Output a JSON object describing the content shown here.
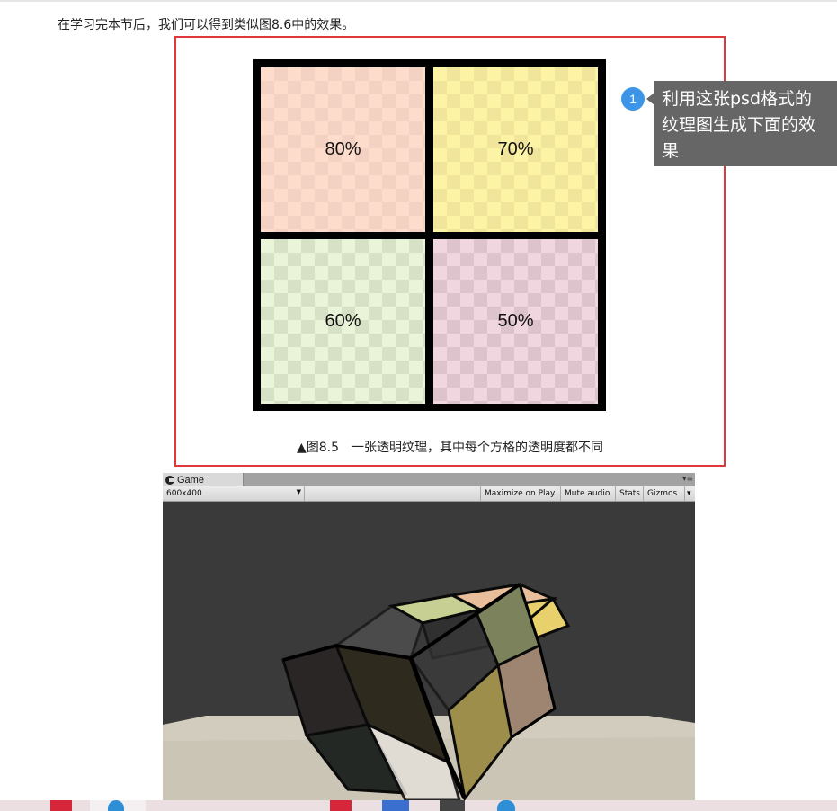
{
  "intro_text": "在学习完本节后，我们可以得到类似图8.6中的效果。",
  "figure": {
    "cells": [
      {
        "label": "80%",
        "color": "#fddccb",
        "check": "#f3d2c3"
      },
      {
        "label": "70%",
        "color": "#fdf3a5",
        "check": "#f0e59b"
      },
      {
        "label": "60%",
        "color": "#eaf4d8",
        "check": "#d7e1c6"
      },
      {
        "label": "50%",
        "color": "#f0d6df",
        "check": "#dcc3cc"
      }
    ],
    "caption": "▲图8.5　一张透明纹理，其中每个方格的透明度都不同",
    "highlight_color": "#e2373a"
  },
  "annotation": {
    "number": "1",
    "lines": [
      "利用这张psd格式的",
      "纹理图生成下面的效",
      "果"
    ]
  },
  "game_window": {
    "tab_label": "Game",
    "menu_glyph": "▾≡",
    "resolution": "600x400",
    "buttons": [
      "Maximize on Play",
      "Mute audio",
      "Stats",
      "Gizmos"
    ],
    "gizmos_caret": "▾"
  },
  "colors": {
    "accent_blue": "#3c95e6",
    "note_bg": "#666666",
    "viewport_bg": "#3a3a3a"
  }
}
